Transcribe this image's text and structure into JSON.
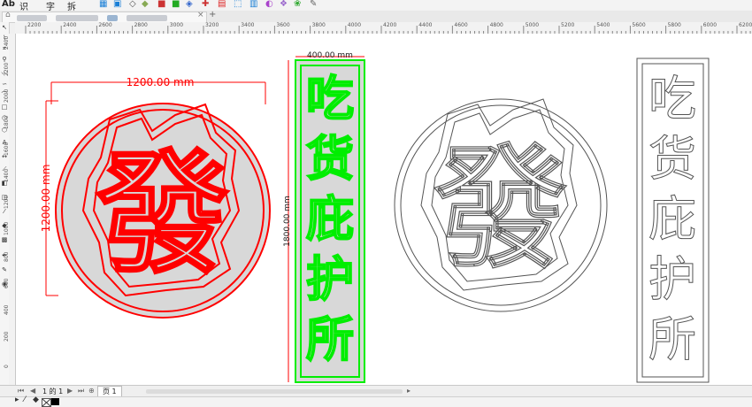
{
  "toolbar": {
    "labels": [
      "识",
      "字",
      "拆"
    ]
  },
  "ruler": {
    "x_labels": [
      "2200",
      "2400",
      "2600",
      "2800",
      "3000",
      "3200",
      "3400",
      "3600",
      "3800",
      "4000",
      "4200",
      "4400",
      "4600",
      "4800",
      "5000",
      "5200",
      "5400",
      "5600",
      "5800",
      "6000",
      "6200"
    ],
    "y_labels": [
      "2400",
      "2200",
      "2000",
      "1800",
      "1600",
      "1400",
      "1200",
      "1000",
      "800",
      "600",
      "400",
      "200",
      "0"
    ]
  },
  "design": {
    "circle_width_dim": "1200.00 mm",
    "circle_height_dim": "1200.00 mm",
    "circle_char": "發",
    "banner_width_dim": "400.00 mm",
    "banner_height_dim": "1800.00 mm",
    "banner_chars": [
      "吃",
      "货",
      "庇",
      "护",
      "所"
    ]
  },
  "status": {
    "page_nav": "1 的 1",
    "page_tab": "页 1"
  },
  "colors": {
    "red": "#ff0000",
    "green": "#00ee00",
    "fill": "#d9d9d9",
    "outline": "#555555"
  }
}
